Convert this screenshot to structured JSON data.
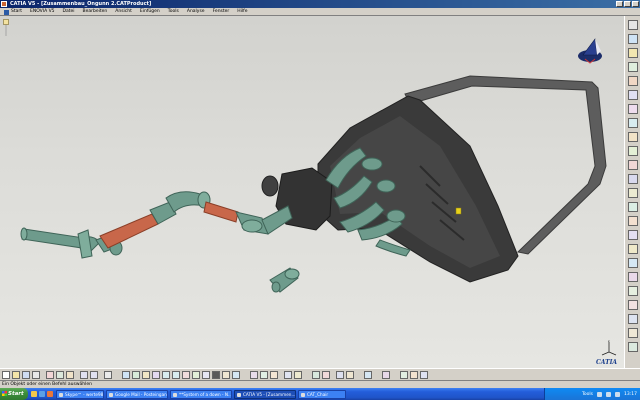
{
  "window": {
    "title": "CATIA V5 - [Zusammenbau_Ongunn 2.CATProduct]"
  },
  "menu": {
    "items": [
      "Start",
      "ENOVIA V5",
      "Datei",
      "Bearbeiten",
      "Ansicht",
      "Einfügen",
      "Tools",
      "Analyse",
      "Fenster",
      "Hilfe"
    ]
  },
  "status": {
    "text": "Ein Objekt oder einen Befehl auswählen"
  },
  "taskbar": {
    "start_label": "Start",
    "tasks": [
      "Skype™ - werte98",
      "Google Mail - Posteingan...",
      "**System of a down - N...",
      "CATIA V5 - [Zusammen...",
      "CAT_Chair"
    ],
    "active_index": 3,
    "clock": "13:17",
    "tools_label": "Tools"
  },
  "brand": {
    "logo_text": "CATIA"
  },
  "colors": {
    "background": "#dcdcd8",
    "pipe_green": "#6e9b8c",
    "pipe_orange": "#c8674a",
    "body_dark": "#3a3a3a",
    "title_blue": "#0a246a",
    "taskbar_blue": "#245edb"
  }
}
